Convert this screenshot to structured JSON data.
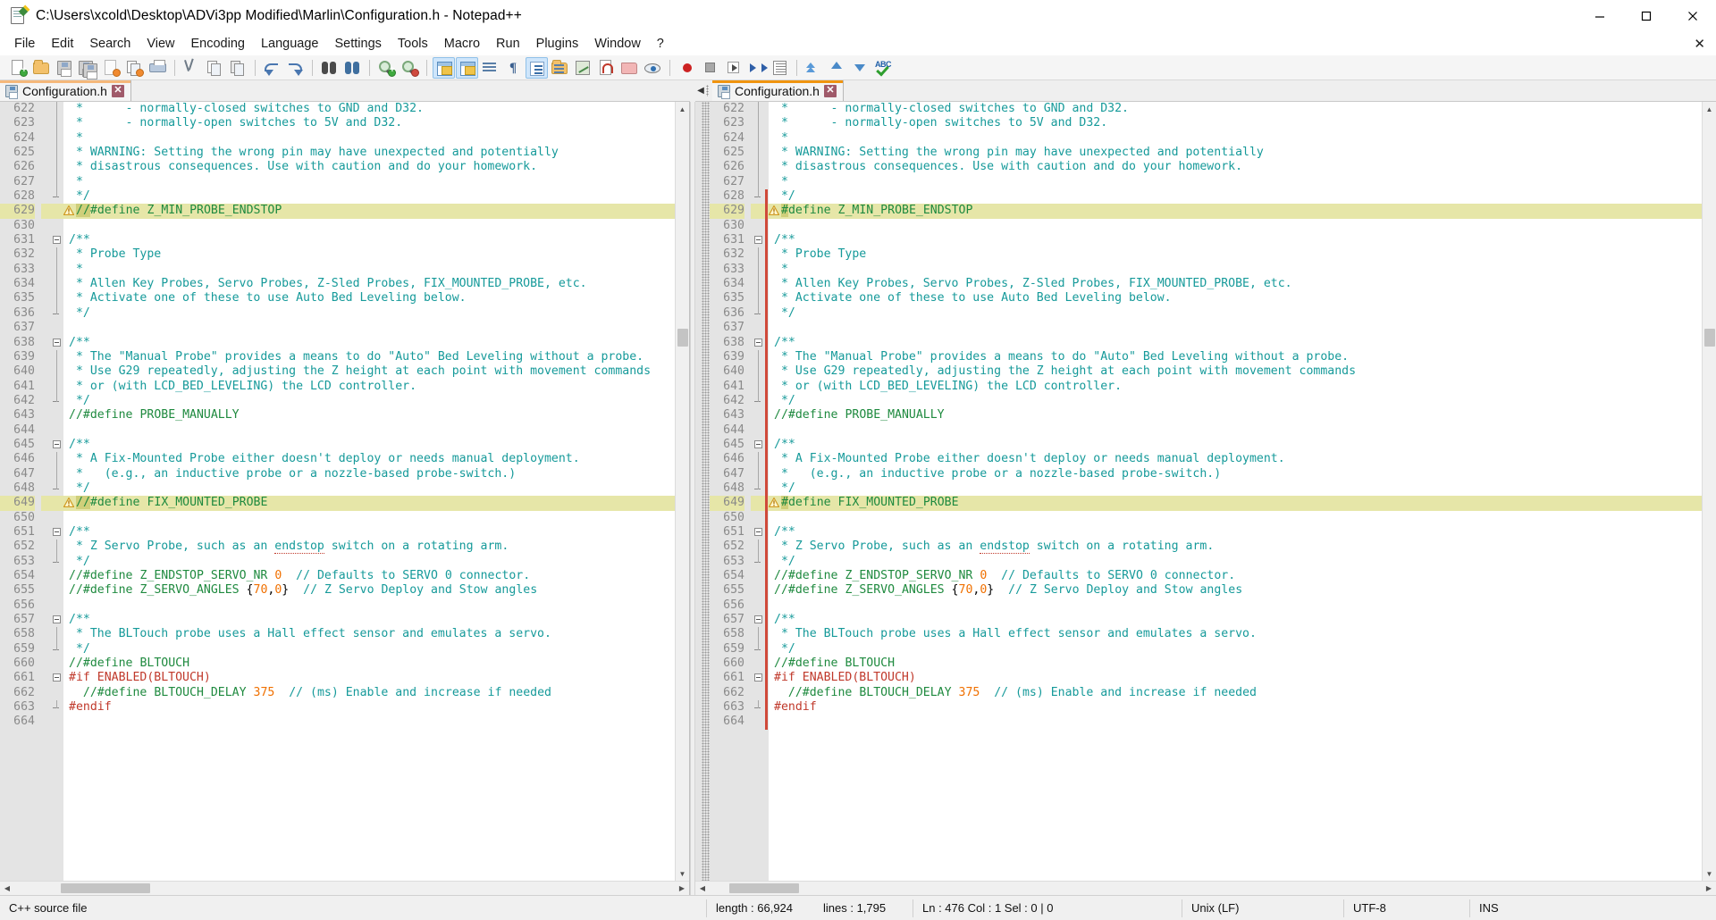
{
  "window": {
    "title": "C:\\Users\\xcold\\Desktop\\ADVi3pp Modified\\Marlin\\Configuration.h - Notepad++",
    "minimize_label": "–",
    "maximize_label": "❐",
    "close_label": "✕"
  },
  "menu": {
    "items": [
      "File",
      "Edit",
      "Search",
      "View",
      "Encoding",
      "Language",
      "Settings",
      "Tools",
      "Macro",
      "Run",
      "Plugins",
      "Window",
      "?"
    ],
    "doc_close_label": "✕"
  },
  "toolbar": {
    "buttons": [
      {
        "name": "new-file",
        "tip": "New"
      },
      {
        "name": "open-file",
        "tip": "Open"
      },
      {
        "name": "save-file",
        "tip": "Save"
      },
      {
        "name": "save-all",
        "tip": "Save All"
      },
      {
        "name": "close-file",
        "tip": "Close"
      },
      {
        "name": "close-all",
        "tip": "Close All"
      },
      {
        "name": "print",
        "tip": "Print"
      },
      {
        "name": "cut",
        "tip": "Cut"
      },
      {
        "name": "copy",
        "tip": "Copy"
      },
      {
        "name": "paste",
        "tip": "Paste"
      },
      {
        "name": "undo",
        "tip": "Undo"
      },
      {
        "name": "redo",
        "tip": "Redo"
      },
      {
        "name": "find",
        "tip": "Find"
      },
      {
        "name": "replace",
        "tip": "Replace"
      },
      {
        "name": "zoom-in",
        "tip": "Zoom In"
      },
      {
        "name": "zoom-out",
        "tip": "Zoom Out"
      },
      {
        "name": "sync-vertical-scroll",
        "tip": "Synchronize Vertical Scrolling"
      },
      {
        "name": "sync-horizontal-scroll",
        "tip": "Synchronize Horizontal Scrolling"
      },
      {
        "name": "word-wrap",
        "tip": "Word wrap"
      },
      {
        "name": "show-all-characters",
        "tip": "Show All Characters"
      },
      {
        "name": "show-indent-guide",
        "tip": "Show Indent Guide"
      },
      {
        "name": "user-defined-dialog",
        "tip": "User Defined Dialogue"
      },
      {
        "name": "document-map",
        "tip": "Document Map"
      },
      {
        "name": "function-list",
        "tip": "Function List"
      },
      {
        "name": "folder-as-workspace",
        "tip": "Folder as Workspace"
      },
      {
        "name": "monitoring",
        "tip": "Monitoring"
      },
      {
        "name": "record-macro",
        "tip": "Start Recording"
      },
      {
        "name": "stop-macro",
        "tip": "Stop Recording"
      },
      {
        "name": "play-macro",
        "tip": "Playback"
      },
      {
        "name": "run-macro-multiple",
        "tip": "Run a Macro Multiple Times"
      },
      {
        "name": "save-macro",
        "tip": "Save Currently Recorded Macro"
      }
    ]
  },
  "tabs": {
    "left": {
      "label": "Configuration.h",
      "close_label": "✕",
      "active": true
    },
    "right": {
      "label": "Configuration.h",
      "close_label": "✕",
      "active": true,
      "scroll_arrow": "◀"
    }
  },
  "editor": {
    "first_line": 622,
    "left": {
      "lines": [
        {
          "n": 622,
          "text": " *      - normally-closed switches to GND and D32.",
          "kind": "comment"
        },
        {
          "n": 623,
          "text": " *      - normally-open switches to 5V and D32.",
          "kind": "comment"
        },
        {
          "n": 624,
          "text": " *",
          "kind": "comment"
        },
        {
          "n": 625,
          "text": " * WARNING: Setting the wrong pin may have unexpected and potentially",
          "kind": "comment"
        },
        {
          "n": 626,
          "text": " * disastrous consequences. Use with caution and do your homework.",
          "kind": "comment"
        },
        {
          "n": 627,
          "text": " *",
          "kind": "comment"
        },
        {
          "n": 628,
          "text": " */",
          "kind": "comment",
          "fold": "end"
        },
        {
          "n": 629,
          "text": "//#define Z_MIN_PROBE_ENDSTOP",
          "kind": "commented-define",
          "highlight": true,
          "warn": true,
          "smart": "//"
        },
        {
          "n": 630,
          "text": "",
          "kind": "blank"
        },
        {
          "n": 631,
          "text": "/**",
          "kind": "comment",
          "fold": "start"
        },
        {
          "n": 632,
          "text": " * Probe Type",
          "kind": "comment"
        },
        {
          "n": 633,
          "text": " *",
          "kind": "comment"
        },
        {
          "n": 634,
          "text": " * Allen Key Probes, Servo Probes, Z-Sled Probes, FIX_MOUNTED_PROBE, etc.",
          "kind": "comment"
        },
        {
          "n": 635,
          "text": " * Activate one of these to use Auto Bed Leveling below.",
          "kind": "comment"
        },
        {
          "n": 636,
          "text": " */",
          "kind": "comment",
          "fold": "end"
        },
        {
          "n": 637,
          "text": "",
          "kind": "blank"
        },
        {
          "n": 638,
          "text": "/**",
          "kind": "comment",
          "fold": "start"
        },
        {
          "n": 639,
          "text": " * The \"Manual Probe\" provides a means to do \"Auto\" Bed Leveling without a probe.",
          "kind": "comment"
        },
        {
          "n": 640,
          "text": " * Use G29 repeatedly, adjusting the Z height at each point with movement commands",
          "kind": "comment"
        },
        {
          "n": 641,
          "text": " * or (with LCD_BED_LEVELING) the LCD controller.",
          "kind": "comment"
        },
        {
          "n": 642,
          "text": " */",
          "kind": "comment",
          "fold": "end"
        },
        {
          "n": 643,
          "text": "//#define PROBE_MANUALLY",
          "kind": "commented-define"
        },
        {
          "n": 644,
          "text": "",
          "kind": "blank"
        },
        {
          "n": 645,
          "text": "/**",
          "kind": "comment",
          "fold": "start"
        },
        {
          "n": 646,
          "text": " * A Fix-Mounted Probe either doesn't deploy or needs manual deployment.",
          "kind": "comment"
        },
        {
          "n": 647,
          "text": " *   (e.g., an inductive probe or a nozzle-based probe-switch.)",
          "kind": "comment"
        },
        {
          "n": 648,
          "text": " */",
          "kind": "comment",
          "fold": "end"
        },
        {
          "n": 649,
          "text": "//#define FIX_MOUNTED_PROBE",
          "kind": "commented-define",
          "highlight": true,
          "warn": true,
          "smart": "//"
        },
        {
          "n": 650,
          "text": "",
          "kind": "blank"
        },
        {
          "n": 651,
          "text": "/**",
          "kind": "comment",
          "fold": "start"
        },
        {
          "n": 652,
          "text": " * Z Servo Probe, such as an endstop switch on a rotating arm.",
          "kind": "comment",
          "spell": "endstop"
        },
        {
          "n": 653,
          "text": " */",
          "kind": "comment",
          "fold": "end"
        },
        {
          "n": 654,
          "text": "//#define Z_ENDSTOP_SERVO_NR 0  // Defaults to SERVO 0 connector.",
          "kind": "commented-define"
        },
        {
          "n": 655,
          "text": "//#define Z_SERVO_ANGLES {70,0}  // Z Servo Deploy and Stow angles",
          "kind": "commented-define"
        },
        {
          "n": 656,
          "text": "",
          "kind": "blank"
        },
        {
          "n": 657,
          "text": "/**",
          "kind": "comment",
          "fold": "start"
        },
        {
          "n": 658,
          "text": " * The BLTouch probe uses a Hall effect sensor and emulates a servo.",
          "kind": "comment"
        },
        {
          "n": 659,
          "text": " */",
          "kind": "comment",
          "fold": "end"
        },
        {
          "n": 660,
          "text": "//#define BLTOUCH",
          "kind": "commented-define"
        },
        {
          "n": 661,
          "text": "#if ENABLED(BLTOUCH)",
          "kind": "preproc-if",
          "fold": "start"
        },
        {
          "n": 662,
          "text": "  //#define BLTOUCH_DELAY 375  // (ms) Enable and increase if needed",
          "kind": "commented-define"
        },
        {
          "n": 663,
          "text": "#endif",
          "kind": "preproc-if",
          "fold": "end"
        },
        {
          "n": 664,
          "text": "",
          "kind": "blank"
        }
      ]
    },
    "right": {
      "lines": [
        {
          "n": 622,
          "text": " *      - normally-closed switches to GND and D32.",
          "kind": "comment"
        },
        {
          "n": 623,
          "text": " *      - normally-open switches to 5V and D32.",
          "kind": "comment"
        },
        {
          "n": 624,
          "text": " *",
          "kind": "comment"
        },
        {
          "n": 625,
          "text": " * WARNING: Setting the wrong pin may have unexpected and potentially",
          "kind": "comment"
        },
        {
          "n": 626,
          "text": " * disastrous consequences. Use with caution and do your homework.",
          "kind": "comment"
        },
        {
          "n": 627,
          "text": " *",
          "kind": "comment"
        },
        {
          "n": 628,
          "text": " */",
          "kind": "comment",
          "fold": "end",
          "changed": true
        },
        {
          "n": 629,
          "text": "#define Z_MIN_PROBE_ENDSTOP",
          "kind": "define",
          "highlight": true,
          "warn": true,
          "changed": true,
          "smart": "#"
        },
        {
          "n": 630,
          "text": "",
          "kind": "blank",
          "changed": true
        },
        {
          "n": 631,
          "text": "/**",
          "kind": "comment",
          "fold": "start",
          "changed": true
        },
        {
          "n": 632,
          "text": " * Probe Type",
          "kind": "comment",
          "changed": true
        },
        {
          "n": 633,
          "text": " *",
          "kind": "comment",
          "changed": true
        },
        {
          "n": 634,
          "text": " * Allen Key Probes, Servo Probes, Z-Sled Probes, FIX_MOUNTED_PROBE, etc.",
          "kind": "comment",
          "changed": true
        },
        {
          "n": 635,
          "text": " * Activate one of these to use Auto Bed Leveling below.",
          "kind": "comment",
          "changed": true
        },
        {
          "n": 636,
          "text": " */",
          "kind": "comment",
          "fold": "end",
          "changed": true
        },
        {
          "n": 637,
          "text": "",
          "kind": "blank",
          "changed": true
        },
        {
          "n": 638,
          "text": "/**",
          "kind": "comment",
          "fold": "start",
          "changed": true
        },
        {
          "n": 639,
          "text": " * The \"Manual Probe\" provides a means to do \"Auto\" Bed Leveling without a probe.",
          "kind": "comment",
          "changed": true
        },
        {
          "n": 640,
          "text": " * Use G29 repeatedly, adjusting the Z height at each point with movement commands",
          "kind": "comment",
          "changed": true
        },
        {
          "n": 641,
          "text": " * or (with LCD_BED_LEVELING) the LCD controller.",
          "kind": "comment",
          "changed": true
        },
        {
          "n": 642,
          "text": " */",
          "kind": "comment",
          "fold": "end",
          "changed": true
        },
        {
          "n": 643,
          "text": "//#define PROBE_MANUALLY",
          "kind": "commented-define",
          "changed": true
        },
        {
          "n": 644,
          "text": "",
          "kind": "blank",
          "changed": true
        },
        {
          "n": 645,
          "text": "/**",
          "kind": "comment",
          "fold": "start",
          "changed": true
        },
        {
          "n": 646,
          "text": " * A Fix-Mounted Probe either doesn't deploy or needs manual deployment.",
          "kind": "comment",
          "changed": true
        },
        {
          "n": 647,
          "text": " *   (e.g., an inductive probe or a nozzle-based probe-switch.)",
          "kind": "comment",
          "changed": true
        },
        {
          "n": 648,
          "text": " */",
          "kind": "comment",
          "fold": "end",
          "changed": true
        },
        {
          "n": 649,
          "text": "#define FIX_MOUNTED_PROBE",
          "kind": "define",
          "highlight": true,
          "warn": true,
          "changed": true,
          "smart": "#"
        },
        {
          "n": 650,
          "text": "",
          "kind": "blank",
          "changed": true
        },
        {
          "n": 651,
          "text": "/**",
          "kind": "comment",
          "fold": "start",
          "changed": true
        },
        {
          "n": 652,
          "text": " * Z Servo Probe, such as an endstop switch on a rotating arm.",
          "kind": "comment",
          "spell": "endstop",
          "changed": true
        },
        {
          "n": 653,
          "text": " */",
          "kind": "comment",
          "fold": "end",
          "changed": true
        },
        {
          "n": 654,
          "text": "//#define Z_ENDSTOP_SERVO_NR 0  // Defaults to SERVO 0 connector.",
          "kind": "commented-define",
          "changed": true
        },
        {
          "n": 655,
          "text": "//#define Z_SERVO_ANGLES {70,0}  // Z Servo Deploy and Stow angles",
          "kind": "commented-define",
          "changed": true
        },
        {
          "n": 656,
          "text": "",
          "kind": "blank",
          "changed": true
        },
        {
          "n": 657,
          "text": "/**",
          "kind": "comment",
          "fold": "start",
          "changed": true
        },
        {
          "n": 658,
          "text": " * The BLTouch probe uses a Hall effect sensor and emulates a servo.",
          "kind": "comment",
          "changed": true
        },
        {
          "n": 659,
          "text": " */",
          "kind": "comment",
          "fold": "end",
          "changed": true
        },
        {
          "n": 660,
          "text": "//#define BLTOUCH",
          "kind": "commented-define",
          "changed": true
        },
        {
          "n": 661,
          "text": "#if ENABLED(BLTOUCH)",
          "kind": "preproc-if",
          "fold": "start",
          "changed": true
        },
        {
          "n": 662,
          "text": "  //#define BLTOUCH_DELAY 375  // (ms) Enable and increase if needed",
          "kind": "commented-define",
          "changed": true
        },
        {
          "n": 663,
          "text": "#endif",
          "kind": "preproc-if",
          "fold": "end",
          "changed": true
        },
        {
          "n": 664,
          "text": "",
          "kind": "blank",
          "changed": true
        }
      ]
    },
    "scroll": {
      "left_arrow": "◀",
      "right_arrow": "▶",
      "up_arrow": "▲",
      "down_arrow": "▼"
    }
  },
  "statusbar": {
    "doc_type": "C++ source file",
    "length_label": "length : 66,924",
    "lines_label": "lines : 1,795",
    "position_label": "Ln : 476   Col : 1   Sel : 0 | 0",
    "eol": "Unix (LF)",
    "encoding": "UTF-8",
    "insert_mode": "INS"
  },
  "colors": {
    "comment": "#169a9a",
    "define": "#1f8a3f",
    "preproc_if": "#c0392b",
    "highlight_row": "#e6e6a8",
    "smart_highlight": "#cfcf7a",
    "change_marker": "#d04a3a",
    "tab_active_left": "#f5b87a",
    "tab_active_right": "#f0940f",
    "line_number": "#8a8a8a",
    "gutter_bg": "#e4e4e4"
  }
}
